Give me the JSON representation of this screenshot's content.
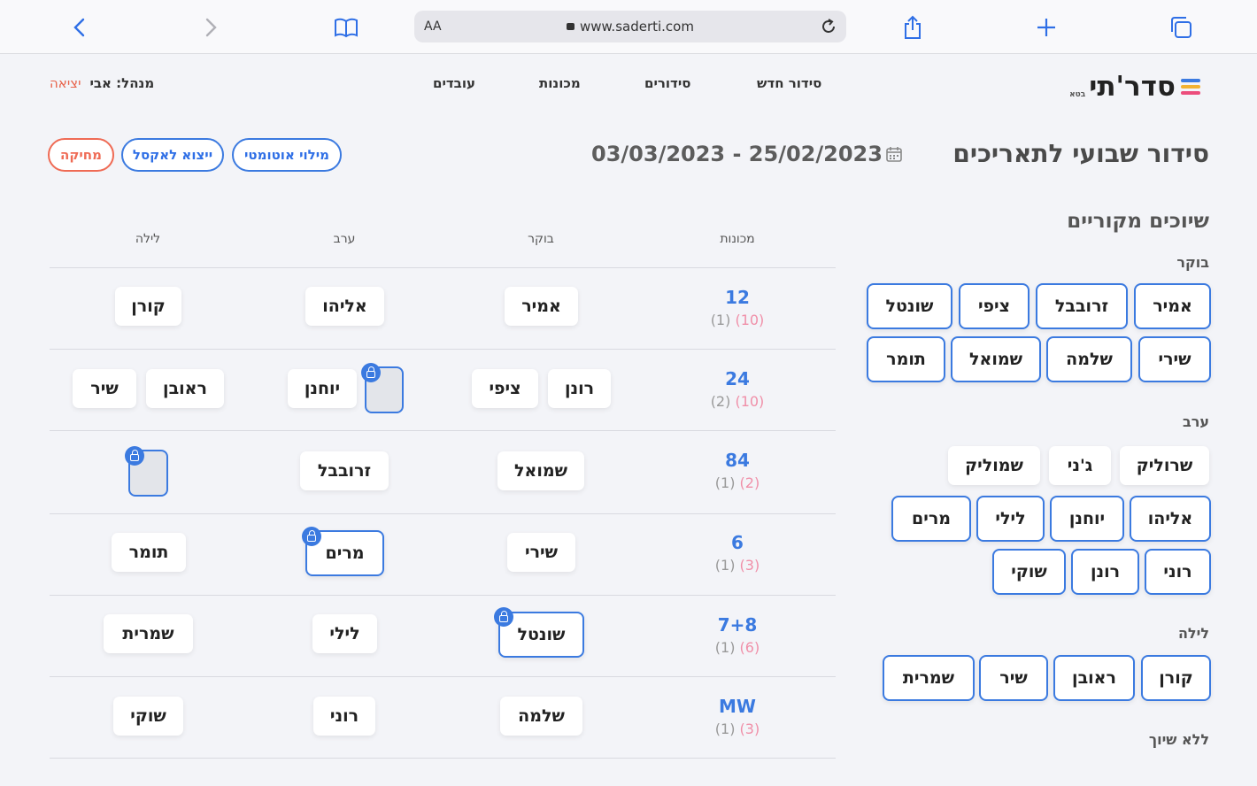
{
  "browser": {
    "url": "www.saderti.com",
    "aa": "AA"
  },
  "app": {
    "logo": "סדר'תי",
    "beta": "בטא",
    "nav": [
      "סידור חדש",
      "סידורים",
      "מכונות",
      "עובדים"
    ],
    "manager": "מנהל: אבי",
    "exit": "יציאה",
    "title": "סידור שבועי לתאריכים",
    "daterange": "03/03/2023 - 25/02/2023",
    "buttons": {
      "autofill": "מילוי אוטומטי",
      "export": "ייצוא לאקסל",
      "delete": "מחיקה"
    },
    "colors": {
      "accent": "#3b7ae0",
      "danger": "#ef6b55",
      "pink": "#f08fa8"
    }
  },
  "assignments": {
    "title": "שיוכים מקוריים",
    "morning_label": "בוקר",
    "morning": [
      "אמיר",
      "זרובבל",
      "ציפי",
      "שונטל",
      "שירי",
      "שלמה",
      "שמואל",
      "תומר"
    ],
    "evening_label": "ערב",
    "evening": [
      "שרוליק",
      "ג'ני",
      "שמוליק",
      "אליהו",
      "יוחנן",
      "לילי",
      "מרים",
      "רוני",
      "רונן",
      "שוקי"
    ],
    "night_label": "לילה",
    "night": [
      "קורן",
      "ראובן",
      "שיר",
      "שמרית"
    ],
    "none_label": "ללא שיוך"
  },
  "table": {
    "headers": {
      "machines": "מכונות",
      "morning": "בוקר",
      "evening": "ערב",
      "night": "לילה"
    },
    "rows": [
      {
        "machine": "12",
        "a": "(1)",
        "b": "(10)",
        "morning": [
          "אמיר"
        ],
        "evening": [
          "אליהו"
        ],
        "night": [
          "קורן"
        ]
      },
      {
        "machine": "24",
        "a": "(2)",
        "b": "(10)",
        "morning": [
          "רונן",
          "ציפי"
        ],
        "evening": [
          "יוחנן"
        ],
        "night": [
          "ראובן",
          "שיר"
        ]
      },
      {
        "machine": "84",
        "a": "(1)",
        "b": "(2)",
        "morning": [
          "שמואל"
        ],
        "evening": [
          "זרובבל"
        ],
        "night": []
      },
      {
        "machine": "6",
        "a": "(1)",
        "b": "(3)",
        "morning": [
          "שירי"
        ],
        "evening": [
          "מרים"
        ],
        "night": [
          "תומר"
        ]
      },
      {
        "machine": "7+8",
        "a": "(1)",
        "b": "(6)",
        "morning": [
          "שונטל"
        ],
        "evening": [
          "לילי"
        ],
        "night": [
          "שמרית"
        ]
      },
      {
        "machine": "MW",
        "a": "(1)",
        "b": "(3)",
        "morning": [
          "שלמה"
        ],
        "evening": [
          "רוני"
        ],
        "night": [
          "שוקי"
        ]
      }
    ]
  }
}
